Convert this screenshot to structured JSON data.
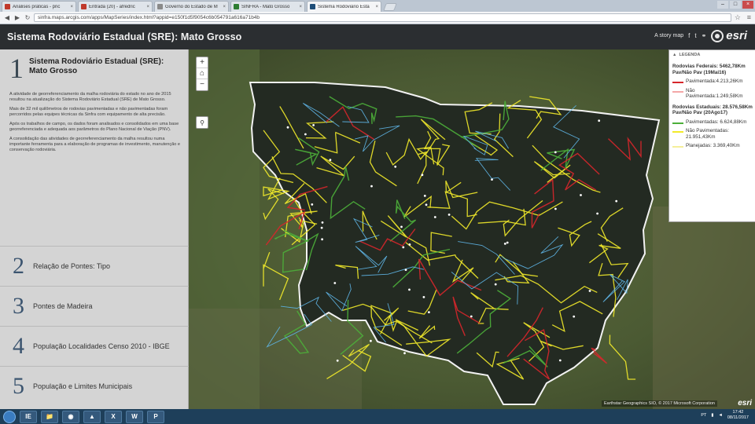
{
  "browser": {
    "tabs": [
      {
        "title": "Análises práticas - pric",
        "active": false,
        "favicon_color": "#c0392b"
      },
      {
        "title": "Entrada (20) - afredric",
        "active": false,
        "favicon_color": "#c0392b"
      },
      {
        "title": "Governo do Estado de M",
        "active": false,
        "favicon_color": "#8a8a8a"
      },
      {
        "title": "SINFRA - Mato Grosso",
        "active": false,
        "favicon_color": "#2e7d32"
      },
      {
        "title": "Sistema Rodoviário Esta",
        "active": true,
        "favicon_color": "#1f4e79"
      }
    ],
    "url": "sinfra.maps.arcgis.com/apps/MapSeries/index.html?appid=e150f1d5f9054c6b054791a616a71b4b",
    "win_min": "–",
    "win_max": "□",
    "win_close": "×"
  },
  "header": {
    "title": "Sistema Rodoviário Estadual (SRE): Mato Grosso",
    "story_map_link": "A story map",
    "esri_logo": "esri"
  },
  "sidebar": {
    "active_section": {
      "number": "1",
      "title": "Sistema Rodoviário Estadual (SRE): Mato Grosso",
      "paragraphs": [
        "A atividade de georreferenciamento da malha rodoviária do estado no ano de 2015 resultou na atualização do Sistema Rodoviário Estadual (SRE) de Mato Grosso.",
        "Mais de 32 mil quilômetros de rodovias pavimentadas e não pavimentadas foram percorridos pelas equipes técnicas da Sinfra com equipamento de alta precisão.",
        "Após os trabalhos de campo, os dados foram analisados e consolidados em uma base georreferenciada e adequada aos parâmetros do Plano Nacional de Viação (PNV).",
        "A consolidação das atividades de georreferenciamento da malha resultou numa importante ferramenta para a elaboração de programas de investimento, manutenção e conservação rodoviária."
      ]
    },
    "sections": [
      {
        "number": "2",
        "label": "Relação de Pontes: Tipo"
      },
      {
        "number": "3",
        "label": "Pontes de Madeira"
      },
      {
        "number": "4",
        "label": "População Localidades Censo 2010 - IBGE"
      },
      {
        "number": "5",
        "label": "População e Limites Municipais"
      }
    ]
  },
  "map": {
    "zoom_in": "+",
    "home": "⌂",
    "zoom_out": "−",
    "search_icon": "⚲",
    "attribution": "Earthstar Geographics SIO, © 2017 Microsoft Corporation",
    "esri_mark": "esri"
  },
  "legend": {
    "header": "LEGENDA",
    "groups": [
      {
        "title": "Rodovias Federais: 5462,78Km Pav/Não Pav (19Mai16)",
        "items": [
          {
            "label": "Pavimentada:4.213,26Km",
            "color": "#d7262b"
          },
          {
            "label": "Não Pavimentada:1.249,58Km",
            "color": "#f4a7a7"
          }
        ]
      },
      {
        "title": "Rodovias Estaduais: 28.576,58Km Pav/Não Pav (20Ago17)",
        "items": [
          {
            "label": "Pavimentadas: 6.624,88Km",
            "color": "#4caf3a"
          },
          {
            "label": "Não Pavimentadas: 21.951,43Km",
            "color": "#f2ea2a"
          },
          {
            "label": "Planejadas: 3.369,40Km",
            "color": "#f5ef9a"
          }
        ]
      }
    ]
  },
  "taskbar": {
    "apps": [
      "IE",
      "📁",
      "◉",
      "▲",
      "X",
      "W",
      "P"
    ],
    "tray_text": "PT",
    "time": "17:42",
    "date": "08/11/2017"
  }
}
